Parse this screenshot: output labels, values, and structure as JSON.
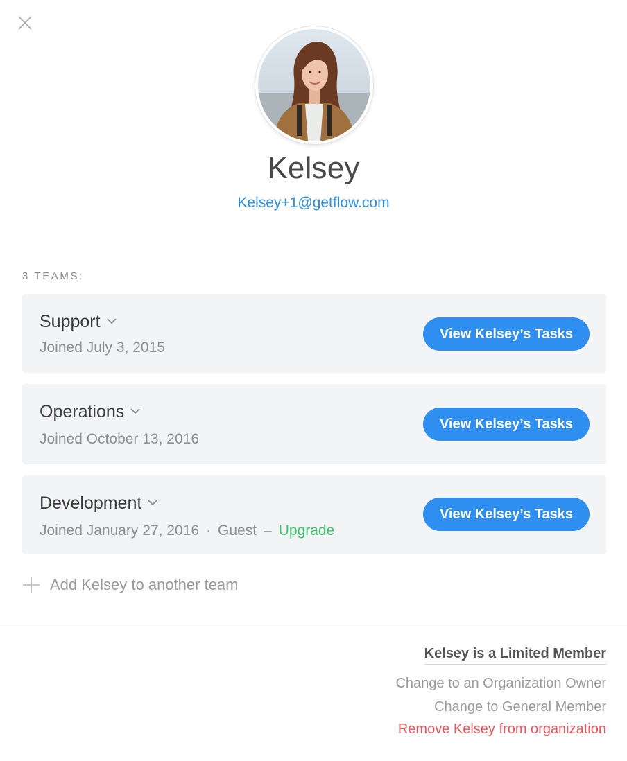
{
  "profile": {
    "name": "Kelsey",
    "email": "Kelsey+1@getflow.com"
  },
  "teams": {
    "heading": "3 TEAMS:",
    "items": [
      {
        "name": "Support",
        "joined": "Joined July 3, 2015",
        "button_label": "View Kelsey’s Tasks"
      },
      {
        "name": "Operations",
        "joined": "Joined October 13, 2016",
        "button_label": "View Kelsey’s Tasks"
      },
      {
        "name": "Development",
        "joined": "Joined January 27, 2016",
        "separator": "·",
        "role": "Guest",
        "dash": "–",
        "upgrade_label": "Upgrade",
        "button_label": "View Kelsey’s Tasks"
      }
    ],
    "add_label": "Add Kelsey to another team"
  },
  "membership": {
    "status": "Kelsey is a Limited Member",
    "change_owner": "Change to an Organization Owner",
    "change_general": "Change to General Member",
    "remove": "Remove Kelsey from organization"
  },
  "colors": {
    "accent": "#2e8ff0",
    "link": "#2f8fe0",
    "upgrade": "#3ec46d",
    "danger": "#e8575d",
    "card_bg": "#f3f4f6"
  },
  "icons": [
    "close-icon",
    "chevron-down-icon",
    "plus-icon"
  ]
}
